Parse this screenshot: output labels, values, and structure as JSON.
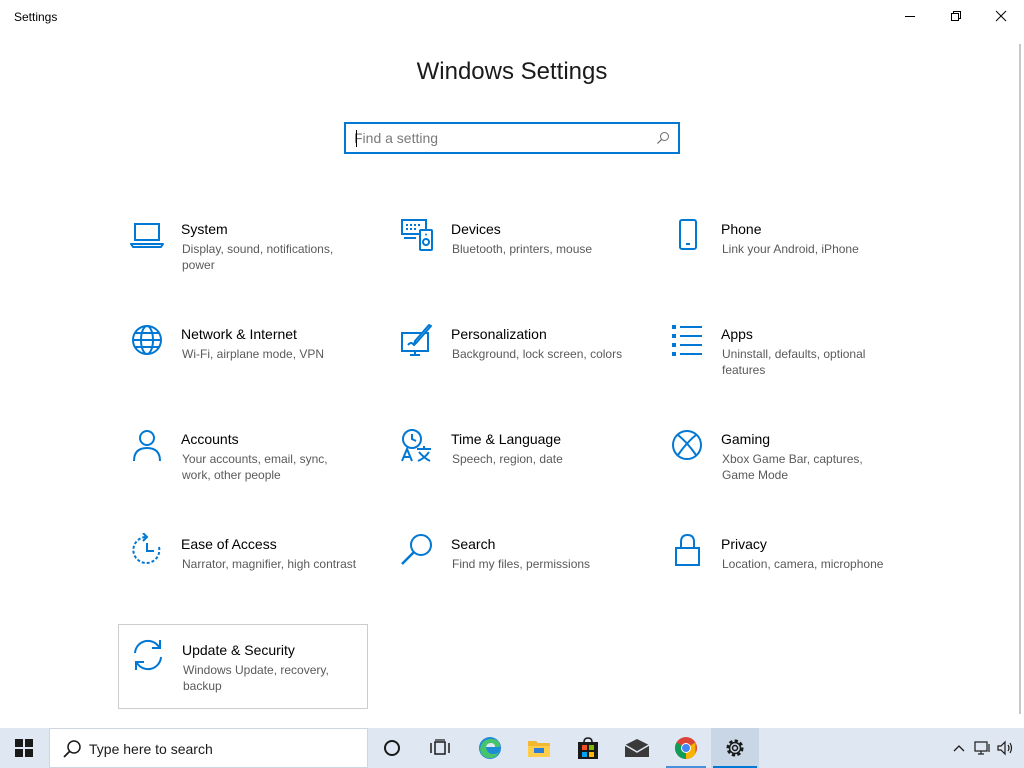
{
  "window": {
    "title": "Settings",
    "controls": {
      "minimize": "minimize-icon",
      "maximize": "restore-icon",
      "close": "close-icon"
    }
  },
  "header": {
    "title": "Windows Settings",
    "search_placeholder": "Find a setting"
  },
  "accent_color": "#0078d4",
  "tiles": [
    {
      "title": "System",
      "desc": "Display, sound, notifications, power",
      "icon": "laptop-icon"
    },
    {
      "title": "Devices",
      "desc": "Bluetooth, printers, mouse",
      "icon": "devices-icon"
    },
    {
      "title": "Phone",
      "desc": "Link your Android, iPhone",
      "icon": "phone-icon"
    },
    {
      "title": "Network & Internet",
      "desc": "Wi-Fi, airplane mode, VPN",
      "icon": "globe-icon"
    },
    {
      "title": "Personalization",
      "desc": "Background, lock screen, colors",
      "icon": "paint-icon"
    },
    {
      "title": "Apps",
      "desc": "Uninstall, defaults, optional features",
      "icon": "apps-list-icon"
    },
    {
      "title": "Accounts",
      "desc": "Your accounts, email, sync, work, other people",
      "icon": "person-icon"
    },
    {
      "title": "Time & Language",
      "desc": "Speech, region, date",
      "icon": "time-language-icon"
    },
    {
      "title": "Gaming",
      "desc": "Xbox Game Bar, captures, Game Mode",
      "icon": "xbox-icon"
    },
    {
      "title": "Ease of Access",
      "desc": "Narrator, magnifier, high contrast",
      "icon": "ease-of-access-icon"
    },
    {
      "title": "Search",
      "desc": "Find my files, permissions",
      "icon": "search-icon"
    },
    {
      "title": "Privacy",
      "desc": "Location, camera, microphone",
      "icon": "lock-icon"
    },
    {
      "title": "Update & Security",
      "desc": "Windows Update, recovery, backup",
      "icon": "sync-icon",
      "selected": true
    }
  ],
  "taskbar": {
    "search_label": "Type here to search",
    "pinned": [
      "cortana-icon",
      "task-view-icon",
      "edge-icon",
      "file-explorer-icon",
      "store-icon",
      "mail-icon",
      "chrome-icon",
      "settings-gear-icon"
    ],
    "tray": [
      "chevron-up-icon",
      "network-icon",
      "volume-icon"
    ]
  }
}
